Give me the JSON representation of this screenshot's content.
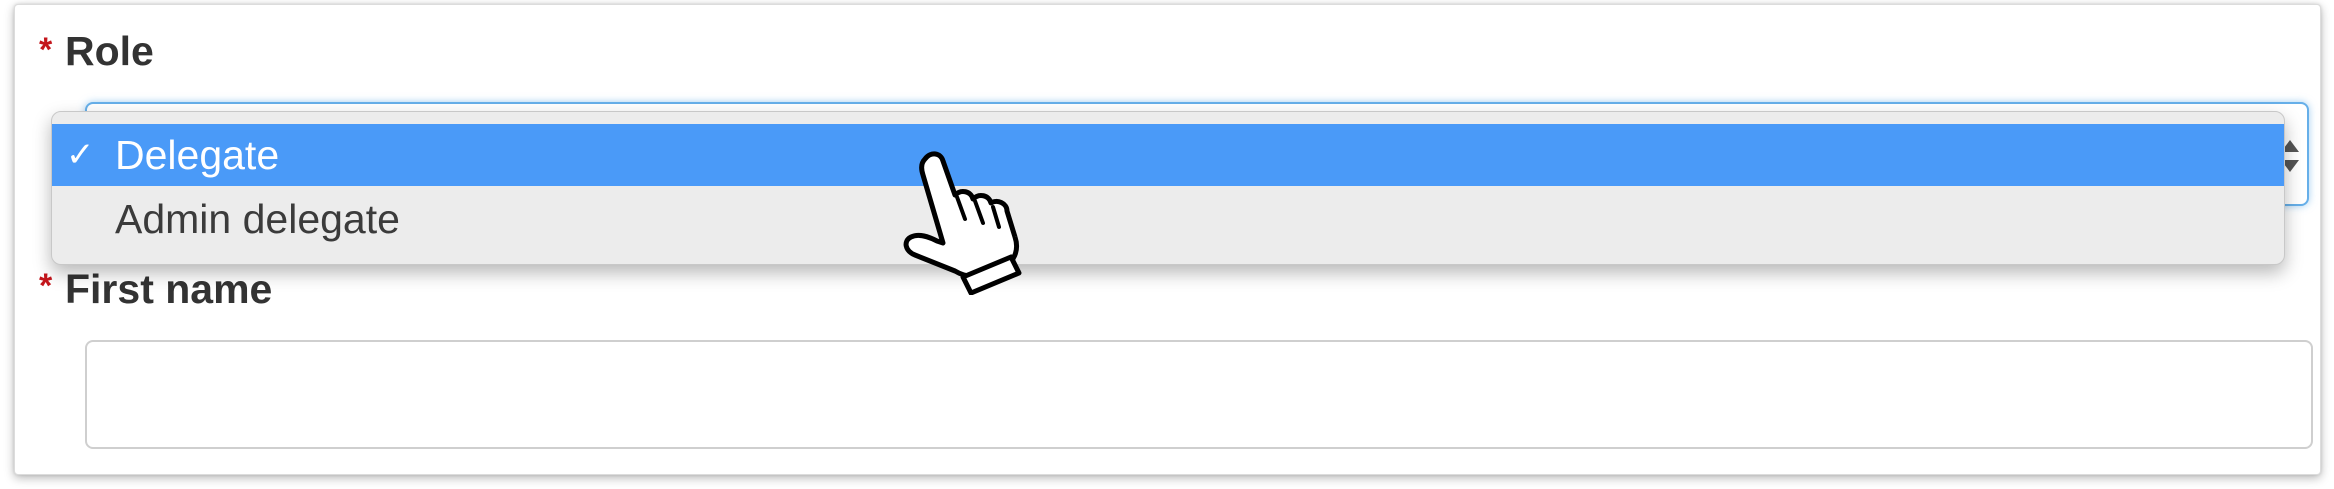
{
  "form": {
    "role": {
      "required_marker": "*",
      "label": "Role",
      "options": [
        {
          "check": "✓",
          "label": "Delegate",
          "selected": true
        },
        {
          "check": "",
          "label": "Admin delegate",
          "selected": false
        }
      ]
    },
    "first_name": {
      "required_marker": "*",
      "label": "First name",
      "value": ""
    }
  },
  "colors": {
    "required": "#c4161c",
    "selected_option_bg": "#4a9af8",
    "focus_border": "#66afe9",
    "label_text": "#333333"
  },
  "icons": [
    "hand-pointer-icon",
    "select-stepper-icon",
    "checkmark-icon"
  ]
}
